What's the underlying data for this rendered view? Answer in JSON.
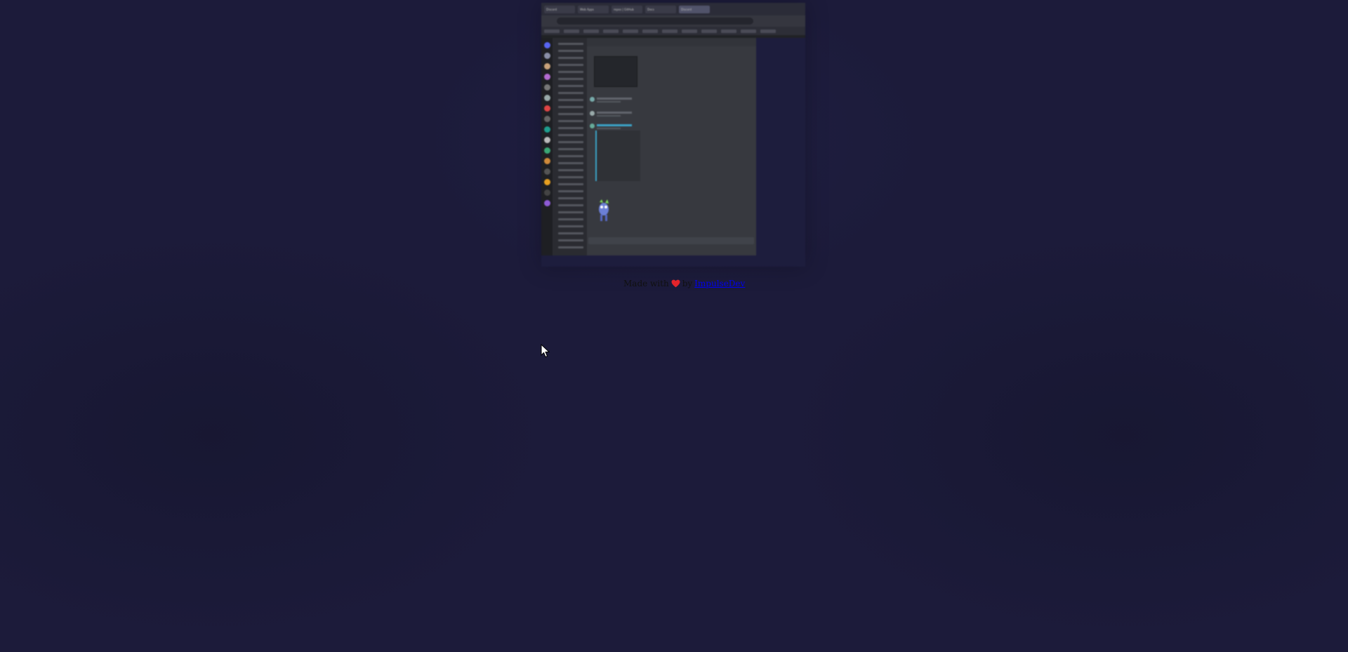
{
  "background_color": "#1c1b3a",
  "embedded_screenshot": {
    "description_icon": "discord-browser-screenshot",
    "tabs": [
      "Discord",
      "Web Apps",
      "repos | GitHub",
      "Docs",
      "Discord"
    ],
    "active_tab_index": 4,
    "accent_color": "#3ba3c7"
  },
  "footer": {
    "prefix": "Made with",
    "heart_icon": "heart-icon",
    "by": "by",
    "author_link": "ImpulseDev",
    "heart_color": "#e3242b",
    "link_color": "#0000ee"
  },
  "cursor_icon": "mouse-pointer-icon"
}
